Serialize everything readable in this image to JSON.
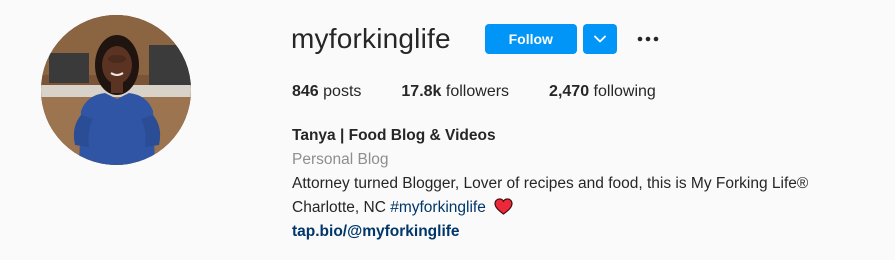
{
  "profile": {
    "username": "myforkinglife",
    "follow_label": "Follow",
    "posts_count": "846",
    "posts_label": "posts",
    "followers_count": "17.8k",
    "followers_label": "followers",
    "following_count": "2,470",
    "following_label": "following",
    "full_name": "Tanya | Food Blog & Videos",
    "category": "Personal Blog",
    "bio_line1": "Attorney turned Blogger, Lover of recipes and food, this is My Forking Life®",
    "bio_location": "Charlotte, NC",
    "bio_hashtag": "#myforkinglife",
    "link": "tap.bio/@myforkinglife"
  },
  "icons": {
    "dropdown": "chevron-down-icon",
    "more": "more-options-icon",
    "heart": "heart-icon"
  },
  "colors": {
    "accent": "#0095f6",
    "link": "#00376b",
    "muted": "#8e8e8e",
    "heart": "#ed2939"
  }
}
